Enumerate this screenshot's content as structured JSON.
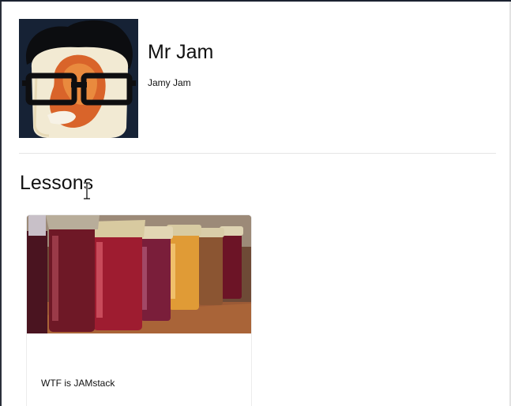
{
  "profile": {
    "name": "Mr Jam",
    "subtitle": "Jamy Jam",
    "avatar_icon": "cartoon-avatar-glasses"
  },
  "lessons": {
    "heading": "Lessons",
    "items": [
      {
        "title": "WTF is JAMstack",
        "image_icon": "jam-jars-photo"
      }
    ]
  },
  "colors": {
    "top_border": "#1b2230",
    "divider": "#e6e6e6",
    "card_border": "#ececec",
    "text": "#111111"
  }
}
